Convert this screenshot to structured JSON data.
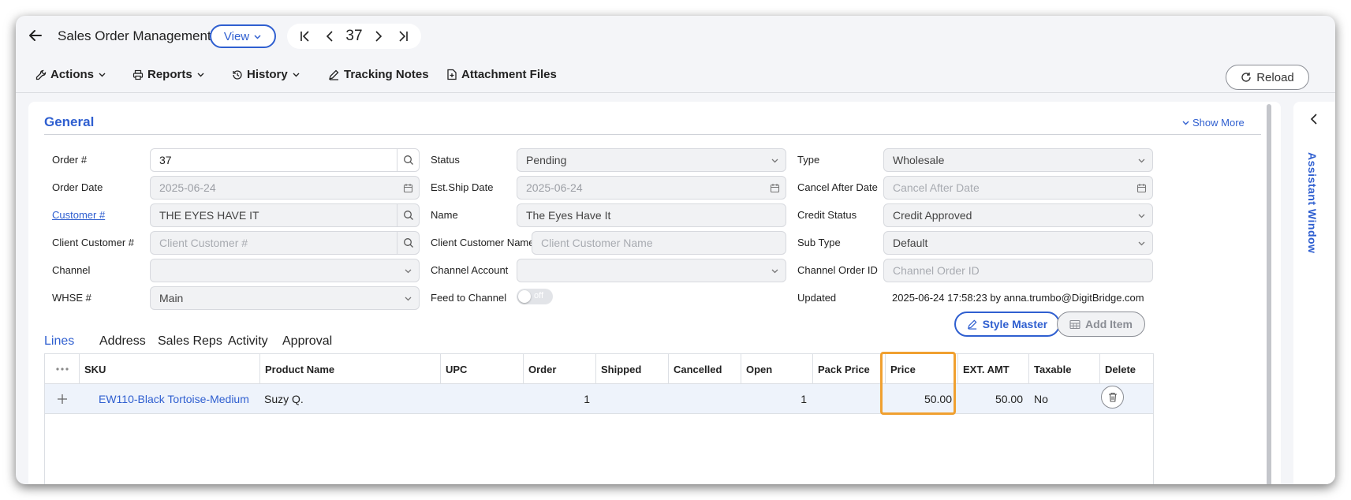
{
  "header": {
    "title": "Sales Order Management",
    "view_label": "View",
    "record_number": "37"
  },
  "toolbar": {
    "actions": "Actions",
    "reports": "Reports",
    "history": "History",
    "tracking_notes": "Tracking Notes",
    "attachment_files": "Attachment Files",
    "reload": "Reload"
  },
  "general": {
    "title": "General",
    "show_more": "Show More",
    "order_no": {
      "label": "Order #",
      "value": "37"
    },
    "order_date": {
      "label": "Order Date",
      "value": "2025-06-24"
    },
    "customer_no": {
      "label": "Customer #",
      "value": "THE EYES HAVE IT"
    },
    "client_customer_no": {
      "label": "Client Customer #",
      "placeholder": "Client Customer #"
    },
    "channel": {
      "label": "Channel",
      "value": ""
    },
    "whse": {
      "label": "WHSE #",
      "value": "Main"
    },
    "status": {
      "label": "Status",
      "value": "Pending"
    },
    "est_ship_date": {
      "label": "Est.Ship Date",
      "value": "2025-06-24"
    },
    "name": {
      "label": "Name",
      "value": "The Eyes Have It"
    },
    "client_customer_name": {
      "label": "Client Customer Name",
      "placeholder": "Client Customer Name"
    },
    "channel_account": {
      "label": "Channel Account",
      "value": ""
    },
    "feed_to_channel": {
      "label": "Feed to Channel",
      "value": "off"
    },
    "type": {
      "label": "Type",
      "value": "Wholesale"
    },
    "cancel_after_date": {
      "label": "Cancel After Date",
      "placeholder": "Cancel After Date"
    },
    "credit_status": {
      "label": "Credit Status",
      "value": "Credit Approved"
    },
    "sub_type": {
      "label": "Sub Type",
      "value": "Default"
    },
    "channel_order_id": {
      "label": "Channel Order ID",
      "placeholder": "Channel Order ID"
    },
    "updated": {
      "label": "Updated",
      "value": "2025-06-24 17:58:23 by anna.trumbo@DigitBridge.com"
    }
  },
  "tabs": [
    "Lines",
    "Address",
    "Sales Reps",
    "Activity",
    "Approval"
  ],
  "lines": {
    "style_master": "Style Master",
    "add_item": "Add Item",
    "columns": [
      "SKU",
      "Product Name",
      "UPC",
      "Order",
      "Shipped",
      "Cancelled",
      "Open",
      "Pack Price",
      "Price",
      "EXT. AMT",
      "Taxable",
      "Delete"
    ],
    "rows": [
      {
        "sku": "EW110-Black Tortoise-Medium",
        "product_name": "Suzy Q.",
        "upc": "",
        "order": "1",
        "shipped": "",
        "cancelled": "",
        "open": "1",
        "pack_price": "",
        "price": "50.00",
        "ext_amt": "50.00",
        "taxable": "No"
      }
    ]
  },
  "assistant": {
    "label": "Assistant Window"
  },
  "colors": {
    "accent": "#2f5fd0",
    "highlight": "#f0a030"
  }
}
